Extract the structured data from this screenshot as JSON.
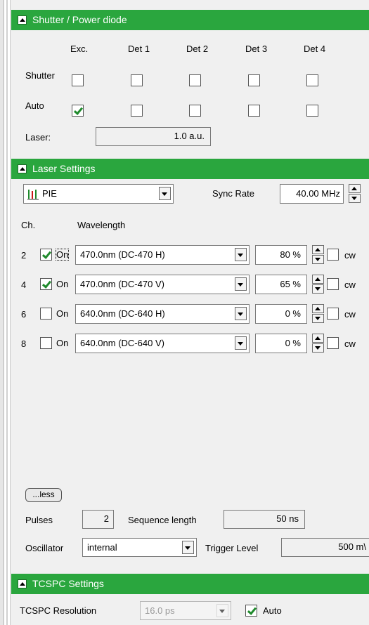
{
  "shutter": {
    "title": "Shutter / Power diode",
    "columns": [
      "Exc.",
      "Det 1",
      "Det 2",
      "Det 3",
      "Det 4"
    ],
    "row_shutter_label": "Shutter",
    "row_auto_label": "Auto",
    "laser_label": "Laser:",
    "laser_value": "1.0 a.u.",
    "shutter_checked": [
      false,
      false,
      false,
      false,
      false
    ],
    "auto_checked": [
      true,
      false,
      false,
      false,
      false
    ]
  },
  "laser": {
    "title": "Laser Settings",
    "mode_value": "PIE",
    "sync_label": "Sync Rate",
    "sync_value": "40.00 MHz",
    "col_ch": "Ch.",
    "col_wavelength": "Wavelength",
    "on_label": "On",
    "cw_label": "cw",
    "channels": [
      {
        "ch": "2",
        "on": true,
        "wavelength": "470.0nm (DC-470 H)",
        "power": "80 %",
        "cw": false
      },
      {
        "ch": "4",
        "on": true,
        "wavelength": "470.0nm (DC-470 V)",
        "power": "65 %",
        "cw": false
      },
      {
        "ch": "6",
        "on": false,
        "wavelength": "640.0nm (DC-640 H)",
        "power": "0 %",
        "cw": false
      },
      {
        "ch": "8",
        "on": false,
        "wavelength": "640.0nm (DC-640 V)",
        "power": "0 %",
        "cw": false
      }
    ],
    "less_label": "...less",
    "pulses_label": "Pulses",
    "pulses_value": "2",
    "seq_label": "Sequence length",
    "seq_value": "50 ns",
    "osc_label": "Oscillator",
    "osc_value": "internal",
    "trigger_label": "Trigger Level",
    "trigger_value": "500 m\\"
  },
  "tcspc": {
    "title": "TCSPC Settings",
    "res_label": "TCSPC Resolution",
    "res_value": "16.0 ps",
    "auto_label": "Auto",
    "auto_checked": true
  },
  "colors": {
    "header_green": "#2aa63e",
    "check_green": "#1f8a2c"
  }
}
